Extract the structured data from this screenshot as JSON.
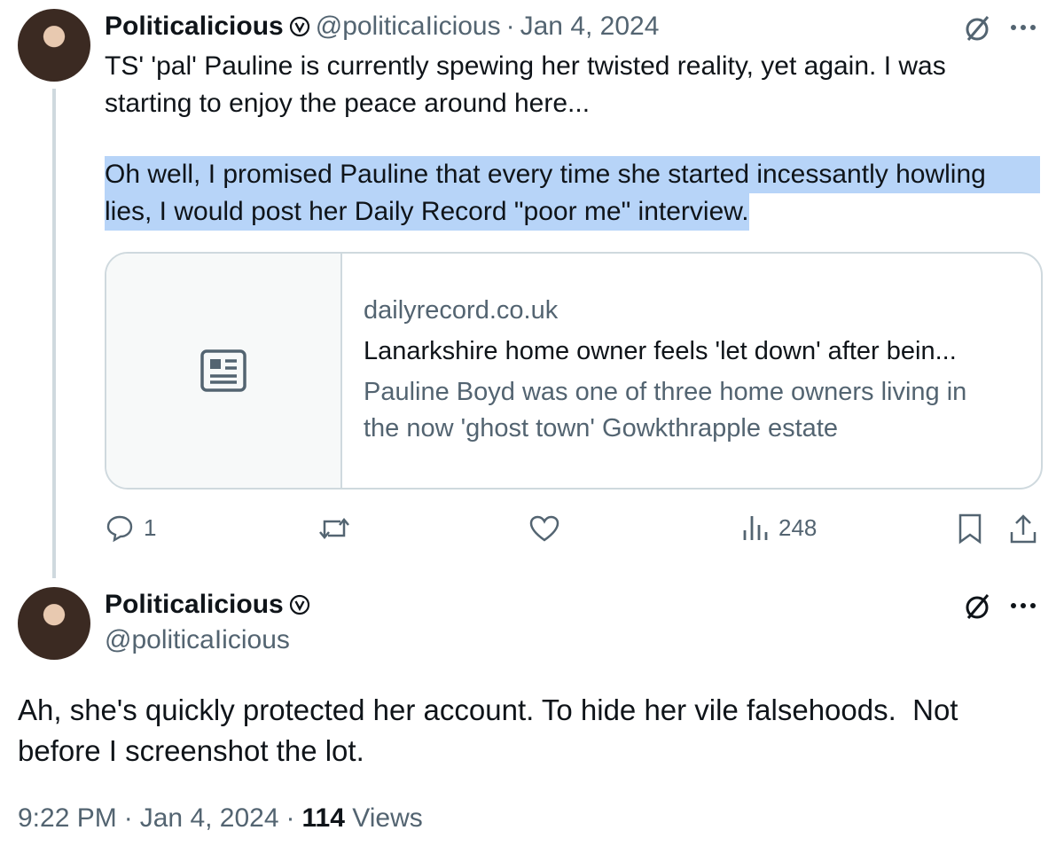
{
  "tweet1": {
    "display_name": "Politicalicious",
    "handle": "@politicaIicious",
    "separator": "·",
    "date": "Jan 4, 2024",
    "text_line1": "TS' 'pal' Pauline is currently spewing her twisted reality, yet again. I was",
    "text_line2": "starting to enjoy the peace around here...",
    "text_line3": "Oh well, I promised Pauline that every time she started incessantly howling",
    "text_line4": "lies, I would post her Daily Record \"poor me\" interview.",
    "card": {
      "domain": "dailyrecord.co.uk",
      "title": "Lanarkshire home owner feels 'let down' after bein...",
      "desc_line1": "Pauline Boyd was one of three home owners living in",
      "desc_line2": "the now 'ghost town' Gowkthrapple estate"
    },
    "actions": {
      "reply_count": "1",
      "views_count": "248"
    }
  },
  "tweet2": {
    "display_name": "Politicalicious",
    "handle": "@politicaIicious",
    "text_line1": "Ah, she's quickly protected her account. To hide her vile falsehoods.  Not",
    "text_line2": "before I screenshot the lot.",
    "time": "9:22 PM",
    "sep1": "·",
    "date": "Jan 4, 2024",
    "sep2": "·",
    "views_count": "114",
    "views_label": "Views"
  },
  "icons": {
    "verified": "verified-badge-icon",
    "grok": "slash-circle-icon",
    "more": "more-dots-icon",
    "article": "article-icon",
    "reply": "reply-icon",
    "retweet": "retweet-icon",
    "like": "heart-icon",
    "views": "views-icon",
    "bookmark": "bookmark-icon",
    "share": "share-icon"
  },
  "colors": {
    "highlight": "#b7d4f8",
    "secondary_text": "#536471",
    "border": "#cfd9de"
  }
}
